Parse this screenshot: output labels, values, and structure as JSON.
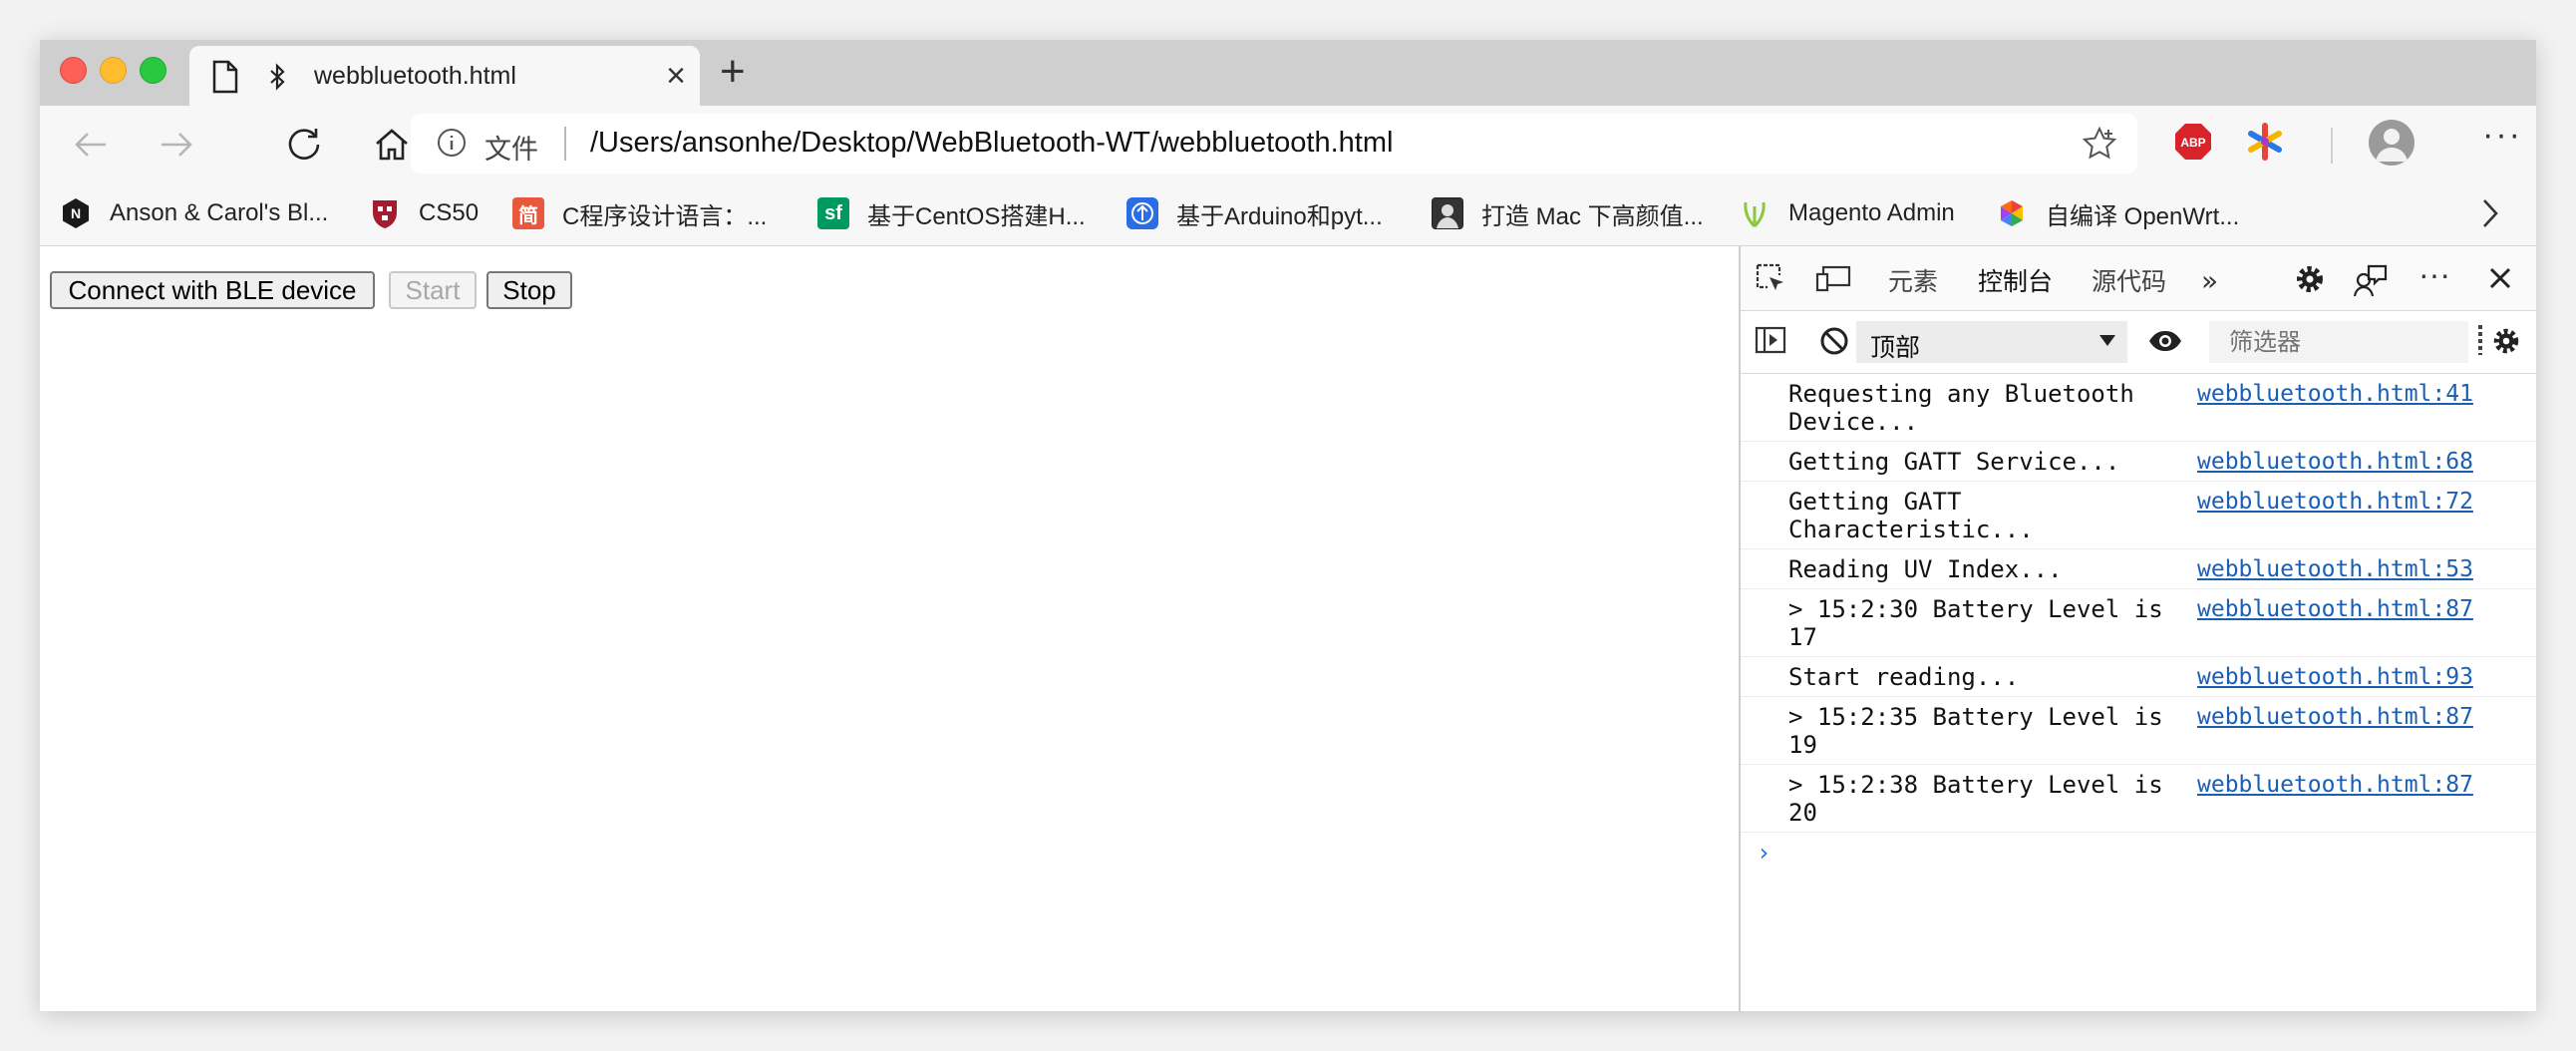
{
  "tab": {
    "title": "webbluetooth.html"
  },
  "address_bar": {
    "security_label": "文件",
    "url": "/Users/ansonhe/Desktop/WebBluetooth-WT/webbluetooth.html"
  },
  "extensions": {
    "adblock": "ABP"
  },
  "bookmarks": [
    {
      "label": "Anson & Carol's Bl...",
      "icon": "N",
      "color": "#1a1a1a"
    },
    {
      "label": "CS50",
      "icon": "shield",
      "color": "#a51c30"
    },
    {
      "label": "C程序设计语言：...",
      "icon": "简",
      "color": "#e8583d"
    },
    {
      "label": "基于CentOS搭建H...",
      "icon": "sf",
      "color": "#009a61"
    },
    {
      "label": "基于Arduino和pyt...",
      "icon": "A",
      "color": "#2b6de5"
    },
    {
      "label": "打造 Mac 下高颜值...",
      "icon": "img",
      "color": "#222222"
    },
    {
      "label": "Magento Admin",
      "icon": "leaf",
      "color": "#8dc63f"
    },
    {
      "label": "自编译 OpenWrt...",
      "icon": "hex",
      "color": "#4285f4"
    }
  ],
  "page": {
    "connect_label": "Connect with BLE device",
    "start_label": "Start",
    "stop_label": "Stop"
  },
  "devtools": {
    "tabs": [
      "元素",
      "控制台",
      "源代码"
    ],
    "active_tab": "控制台",
    "context": "顶部",
    "filter_placeholder": "筛选器",
    "logs": [
      {
        "message": "Requesting any Bluetooth\nDevice...",
        "source": "webbluetooth.html:41"
      },
      {
        "message": "Getting GATT Service...",
        "source": "webbluetooth.html:68"
      },
      {
        "message": "Getting GATT\nCharacteristic...",
        "source": "webbluetooth.html:72"
      },
      {
        "message": "Reading UV Index...",
        "source": "webbluetooth.html:53"
      },
      {
        "message": "> 15:2:30 Battery Level is\n17",
        "source": "webbluetooth.html:87"
      },
      {
        "message": "Start reading...",
        "source": "webbluetooth.html:93"
      },
      {
        "message": "> 15:2:35 Battery Level is\n19",
        "source": "webbluetooth.html:87"
      },
      {
        "message": "> 15:2:38 Battery Level is\n20",
        "source": "webbluetooth.html:87"
      }
    ],
    "prompt": "›"
  }
}
